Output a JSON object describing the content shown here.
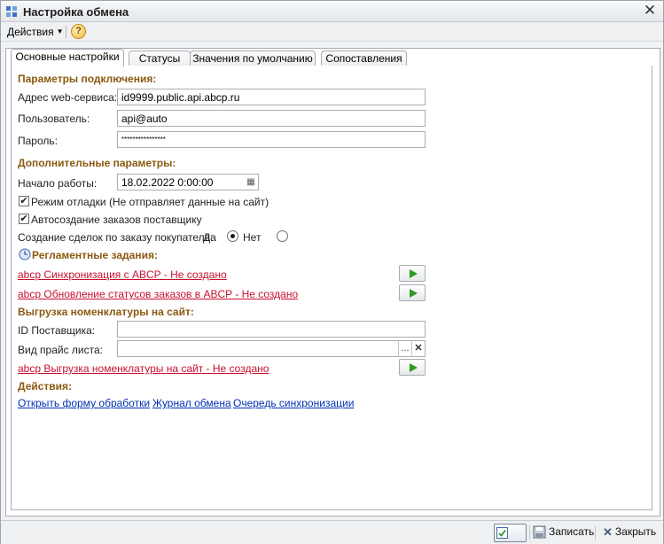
{
  "window": {
    "title": "Настройка обмена"
  },
  "menu": {
    "actions_label": "Действия",
    "help_label": "?"
  },
  "tabs": [
    {
      "label": "Основные настройки",
      "active": true
    },
    {
      "label": "Статусы",
      "active": false
    },
    {
      "label": "Значения по умолчанию",
      "active": false
    },
    {
      "label": "Сопоставления",
      "active": false
    }
  ],
  "connection": {
    "section_title": "Параметры подключения:",
    "address_label": "Адрес web-сервиса:",
    "address_value": "id9999.public.api.abcp.ru",
    "user_label": "Пользователь:",
    "user_value": "api@auto",
    "password_label": "Пароль:",
    "password_value": "****************"
  },
  "additional": {
    "section_title": "Дополнительные параметры:",
    "start_label": "Начало работы:",
    "start_value": "18.02.2022  0:00:00",
    "debug_label": "Режим отладки (Не отправляет данные на сайт)",
    "debug_checked": true,
    "autocreate_label": "Автосоздание заказов поставщику",
    "autocreate_checked": true,
    "deals_label": "Создание сделок по заказу покупателя:",
    "deals_yes": "Да",
    "deals_no": "Нет",
    "deals_selected": "Да"
  },
  "scheduled": {
    "section_title": "Регламентные задания:",
    "task1": "abcp  Синхронизация с ABCP - Не создано",
    "task2": "abcp  Обновление статусов заказов в ABCP - Не создано"
  },
  "nomenclature": {
    "section_title": "Выгрузка номенклатуры на сайт:",
    "supplier_id_label": "ID Поставщика:",
    "supplier_id_value": "",
    "price_type_label": "Вид прайс листа:",
    "price_type_value": "",
    "task": "abcp  Выгрузка номенклатуры на сайт - Не создано"
  },
  "actions": {
    "section_title": "Действия:",
    "open_form": "Открыть форму обработки",
    "exchange_log": "Журнал обмена",
    "sync_queue": "Очередь синхронизации"
  },
  "footer": {
    "ok": "OK",
    "save": "Записать",
    "close": "Закрыть"
  },
  "colors": {
    "section": "#8b5a11",
    "link_red": "#c8102e",
    "link_blue": "#0030b5",
    "play": "#2f9a24"
  }
}
